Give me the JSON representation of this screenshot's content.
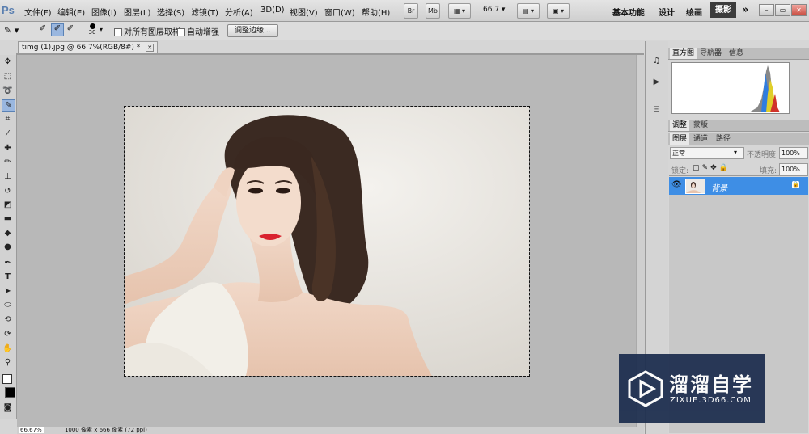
{
  "app": {
    "logo": "Ps"
  },
  "menus": [
    "文件(F)",
    "编辑(E)",
    "图像(I)",
    "图层(L)",
    "选择(S)",
    "滤镜(T)",
    "分析(A)",
    "3D(D)",
    "视图(V)",
    "窗口(W)",
    "帮助(H)"
  ],
  "menubar_buttons": {
    "br": "Br",
    "mb": "Mb",
    "zoom": "66.7"
  },
  "workspaces": [
    "基本功能",
    "设计",
    "绘画",
    "摄影"
  ],
  "workspace_more": "»",
  "window_controls": [
    "–",
    "▭",
    "✕"
  ],
  "options": {
    "brush_size": "30",
    "sample_all_layers": "对所有图层取样",
    "auto_enhance": "自动增强",
    "refine_edge": "调整边缘..."
  },
  "document": {
    "tab_title": "timg (1).jpg @ 66.7%(RGB/8#) *",
    "tab_close": "✕"
  },
  "status": {
    "zoom": "66.67%",
    "info": "1000 像素 x 666 像素 (72 ppi)"
  },
  "panels": {
    "histogram_tabs": [
      "直方图",
      "导航器",
      "信息"
    ],
    "adjust_tabs": [
      "调整",
      "蒙版"
    ],
    "layer_tabs": [
      "图层",
      "通道",
      "路径"
    ],
    "blend_mode": "正常",
    "opacity_label": "不透明度:",
    "opacity_value": "100%",
    "lock_label": "锁定:",
    "fill_label": "填充:",
    "fill_value": "100%",
    "layer_name": "背景"
  },
  "watermark": {
    "title": "溜溜自学",
    "url": "ZIXUE.3D66.COM"
  }
}
